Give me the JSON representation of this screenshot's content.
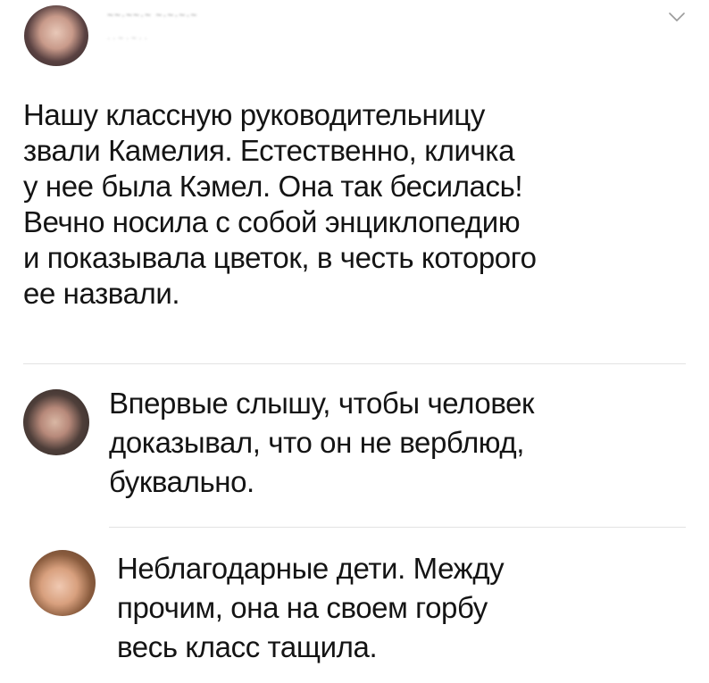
{
  "post": {
    "author_name": "~~·~~·~ ~·~·~·~",
    "author_meta": "· · ~ · ~ ·  ·",
    "text": "Нашу классную руководительницу\nзвали Камелия. Естественно, кличка\nу нее была Кэмел. Она так бесилась!\nВечно носила с собой энциклопедию\nи показывала цветок, в честь которого\nее назвали."
  },
  "comments": [
    {
      "text": "Впервые слышу, чтобы человек\nдоказывал, что он не верблюд,\nбуквально."
    },
    {
      "text": "Неблагодарные дети. Между\nпрочим, она на своем горбу\nвесь класс тащила."
    }
  ],
  "icons": {
    "menu": "chevron-down-icon"
  },
  "colors": {
    "text": "#141414",
    "divider": "#e2e2e2",
    "muted": "#8a8a8a"
  }
}
